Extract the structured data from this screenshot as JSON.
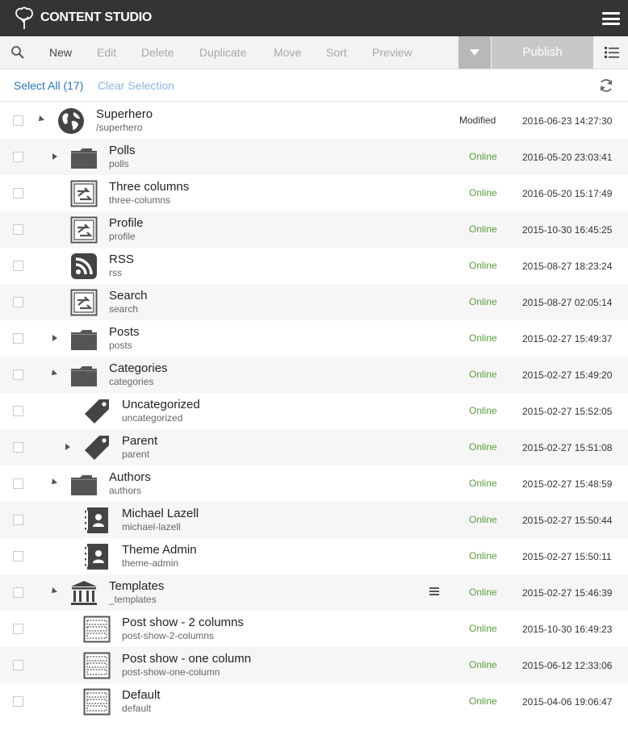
{
  "app": {
    "title": "CONTENT STUDIO"
  },
  "toolbar": {
    "new": "New",
    "edit": "Edit",
    "delete": "Delete",
    "duplicate": "Duplicate",
    "move": "Move",
    "sort": "Sort",
    "preview": "Preview",
    "publish": "Publish"
  },
  "selection": {
    "select_all": "Select All (17)",
    "clear": "Clear Selection"
  },
  "colors": {
    "topbar": "#343434",
    "link": "#2a74c0",
    "online": "#5a9e3a"
  },
  "rows": [
    {
      "name": "Superhero",
      "path": "/superhero",
      "status": "Modified",
      "date": "2016-06-23 14:27:30",
      "icon": "globe-icon",
      "level": 0,
      "toggle": "expanded"
    },
    {
      "name": "Polls",
      "path": "polls",
      "status": "Online",
      "date": "2016-05-20 23:03:41",
      "icon": "folder-icon",
      "level": 1,
      "toggle": "collapsed"
    },
    {
      "name": "Three columns",
      "path": "three-columns",
      "status": "Online",
      "date": "2016-05-20 15:17:49",
      "icon": "page-icon",
      "level": 1,
      "toggle": "none"
    },
    {
      "name": "Profile",
      "path": "profile",
      "status": "Online",
      "date": "2015-10-30 16:45:25",
      "icon": "page-icon",
      "level": 1,
      "toggle": "none"
    },
    {
      "name": "RSS",
      "path": "rss",
      "status": "Online",
      "date": "2015-08-27 18:23:24",
      "icon": "rss-icon",
      "level": 1,
      "toggle": "none"
    },
    {
      "name": "Search",
      "path": "search",
      "status": "Online",
      "date": "2015-08-27 02:05:14",
      "icon": "page-icon",
      "level": 1,
      "toggle": "none"
    },
    {
      "name": "Posts",
      "path": "posts",
      "status": "Online",
      "date": "2015-02-27 15:49:37",
      "icon": "folder-icon",
      "level": 1,
      "toggle": "collapsed"
    },
    {
      "name": "Categories",
      "path": "categories",
      "status": "Online",
      "date": "2015-02-27 15:49:20",
      "icon": "folder-icon",
      "level": 1,
      "toggle": "expanded"
    },
    {
      "name": "Uncategorized",
      "path": "uncategorized",
      "status": "Online",
      "date": "2015-02-27 15:52:05",
      "icon": "tag-icon",
      "level": 2,
      "toggle": "none"
    },
    {
      "name": "Parent",
      "path": "parent",
      "status": "Online",
      "date": "2015-02-27 15:51:08",
      "icon": "tag-icon",
      "level": 2,
      "toggle": "collapsed"
    },
    {
      "name": "Authors",
      "path": "authors",
      "status": "Online",
      "date": "2015-02-27 15:48:59",
      "icon": "folder-icon",
      "level": 1,
      "toggle": "expanded"
    },
    {
      "name": "Michael Lazell",
      "path": "michael-lazell",
      "status": "Online",
      "date": "2015-02-27 15:50:44",
      "icon": "contact-icon",
      "level": 2,
      "toggle": "none"
    },
    {
      "name": "Theme Admin",
      "path": "theme-admin",
      "status": "Online",
      "date": "2015-02-27 15:50:11",
      "icon": "contact-icon",
      "level": 2,
      "toggle": "none"
    },
    {
      "name": "Templates",
      "path": "_templates",
      "status": "Online",
      "date": "2015-02-27 15:46:39",
      "icon": "templates-icon",
      "level": 1,
      "toggle": "expanded",
      "menu": true
    },
    {
      "name": "Post show - 2 columns",
      "path": "post-show-2-columns",
      "status": "Online",
      "date": "2015-10-30 16:49:23",
      "icon": "template-icon",
      "level": 2,
      "toggle": "none"
    },
    {
      "name": "Post show - one column",
      "path": "post-show-one-column",
      "status": "Online",
      "date": "2015-06-12 12:33:06",
      "icon": "template-icon",
      "level": 2,
      "toggle": "none"
    },
    {
      "name": "Default",
      "path": "default",
      "status": "Online",
      "date": "2015-04-06 19:06:47",
      "icon": "template-icon",
      "level": 2,
      "toggle": "none"
    }
  ]
}
